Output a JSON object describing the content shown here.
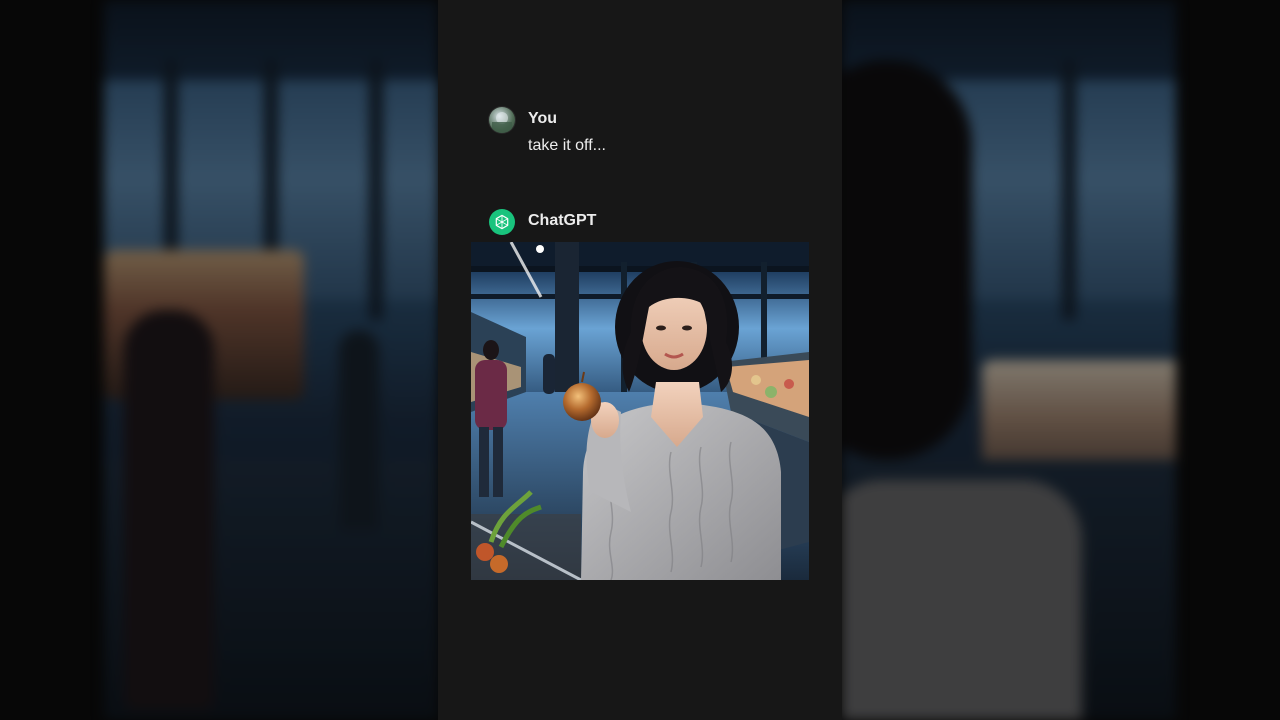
{
  "conversation": {
    "user": {
      "author": "You",
      "message": "take it off..."
    },
    "assistant": {
      "author": "ChatGPT"
    }
  },
  "icons": {
    "user_avatar": "user-avatar-photo",
    "assistant_avatar": "openai-logo-icon"
  },
  "colors": {
    "column_background": "#171717",
    "text": "#ececec",
    "assistant_avatar_bg": "#19c37d"
  }
}
